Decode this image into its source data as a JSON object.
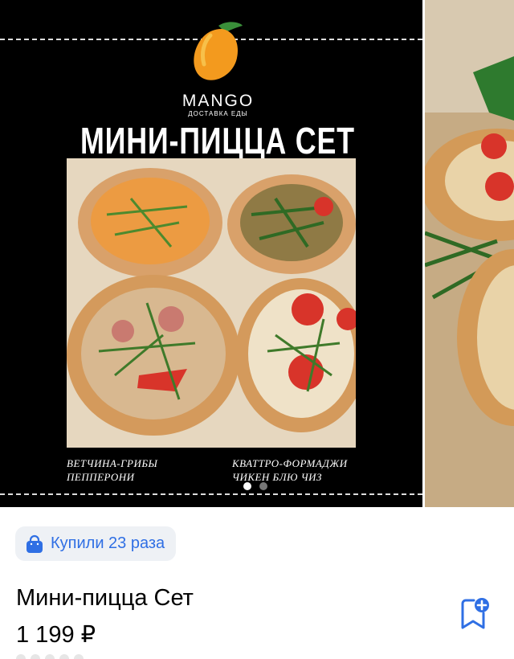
{
  "promo": {
    "brand": "MANGO",
    "brand_subtitle": "ДОСТАВКА ЕДЫ",
    "title": "МИНИ-ПИЦЦА СЕТ",
    "caption_left_line1": "ВЕТЧИНА-ГРИБЫ",
    "caption_left_line2": "ПЕППЕРОНИ",
    "caption_right_line1": "КВАТТРО-ФОРМАДЖИ",
    "caption_right_line2": "ЧИКЕН БЛЮ ЧИЗ"
  },
  "gallery": {
    "active_index": 0,
    "dot_count": 2
  },
  "badge": {
    "icon": "shopping-bag-icon",
    "text": "Купили 23 раза"
  },
  "product": {
    "title": "Мини-пицца Сет",
    "price": "1 199 ₽"
  },
  "colors": {
    "accent": "#2f6fe4",
    "badge_bg": "#eef1f5",
    "logo": "#f39a1e"
  }
}
